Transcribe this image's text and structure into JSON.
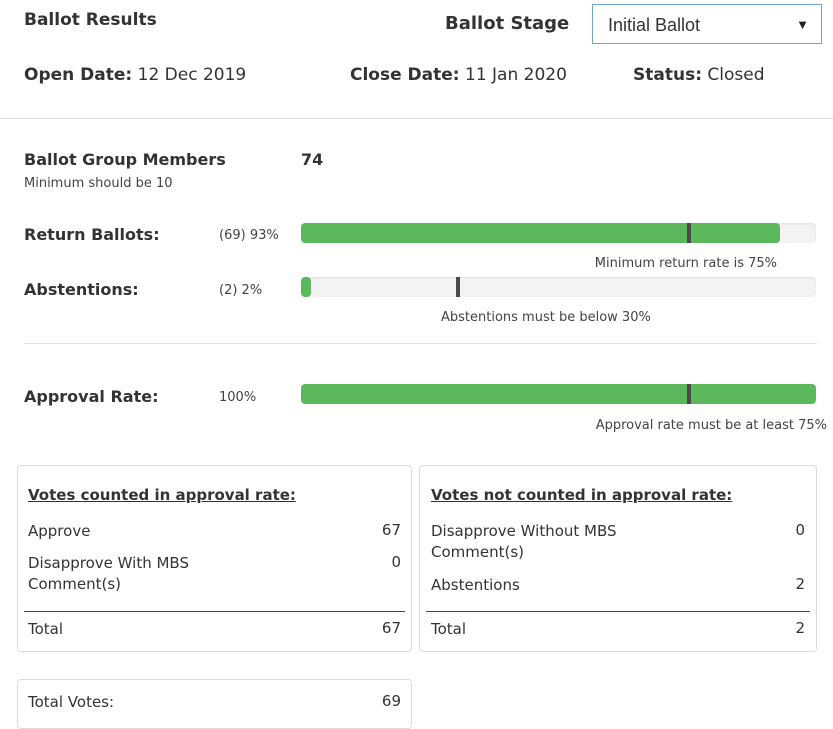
{
  "header": {
    "title": "Ballot Results",
    "stage_label": "Ballot Stage",
    "stage_selected": "Initial Ballot",
    "caret": "▼"
  },
  "meta": {
    "open_key": "Open Date:",
    "open_val": "12 Dec 2019",
    "close_key": "Close Date:",
    "close_val": "11 Jan 2020",
    "status_key": "Status:",
    "status_val": "Closed"
  },
  "members": {
    "label": "Ballot Group Members",
    "count": "74",
    "hint": "Minimum should be 10"
  },
  "bars": {
    "return": {
      "label": "Return Ballots:",
      "value_text": "(69) 93%",
      "fill": 0.93,
      "threshold": 0.75,
      "note": "Minimum return rate is 75%"
    },
    "abstain": {
      "label": "Abstentions:",
      "value_text": "(2) 2%",
      "fill": 0.02,
      "threshold": 0.3,
      "note": "Abstentions must be below 30%"
    },
    "approval": {
      "label": "Approval Rate:",
      "value_text": "100%",
      "fill": 1.0,
      "threshold": 0.75,
      "note": "Approval rate must be at least 75%"
    }
  },
  "counted": {
    "heading": "Votes counted in approval rate:",
    "rows": [
      {
        "label": "Approve",
        "value": "67"
      },
      {
        "label": "Disapprove With MBS Comment(s)",
        "value": "0"
      }
    ],
    "total_label": "Total",
    "total_value": "67"
  },
  "not_counted": {
    "heading": "Votes not counted in approval rate:",
    "rows": [
      {
        "label": "Disapprove Without MBS Comment(s)",
        "value": "0"
      },
      {
        "label": "Abstentions",
        "value": "2"
      }
    ],
    "total_label": "Total",
    "total_value": "2"
  },
  "total_votes": {
    "label": "Total Votes:",
    "value": "69"
  },
  "colors": {
    "bar_fill": "#5cb85c",
    "bar_track": "#f3f3f3",
    "marker": "#4a4a4a",
    "select_border": "#6fa5d8"
  }
}
